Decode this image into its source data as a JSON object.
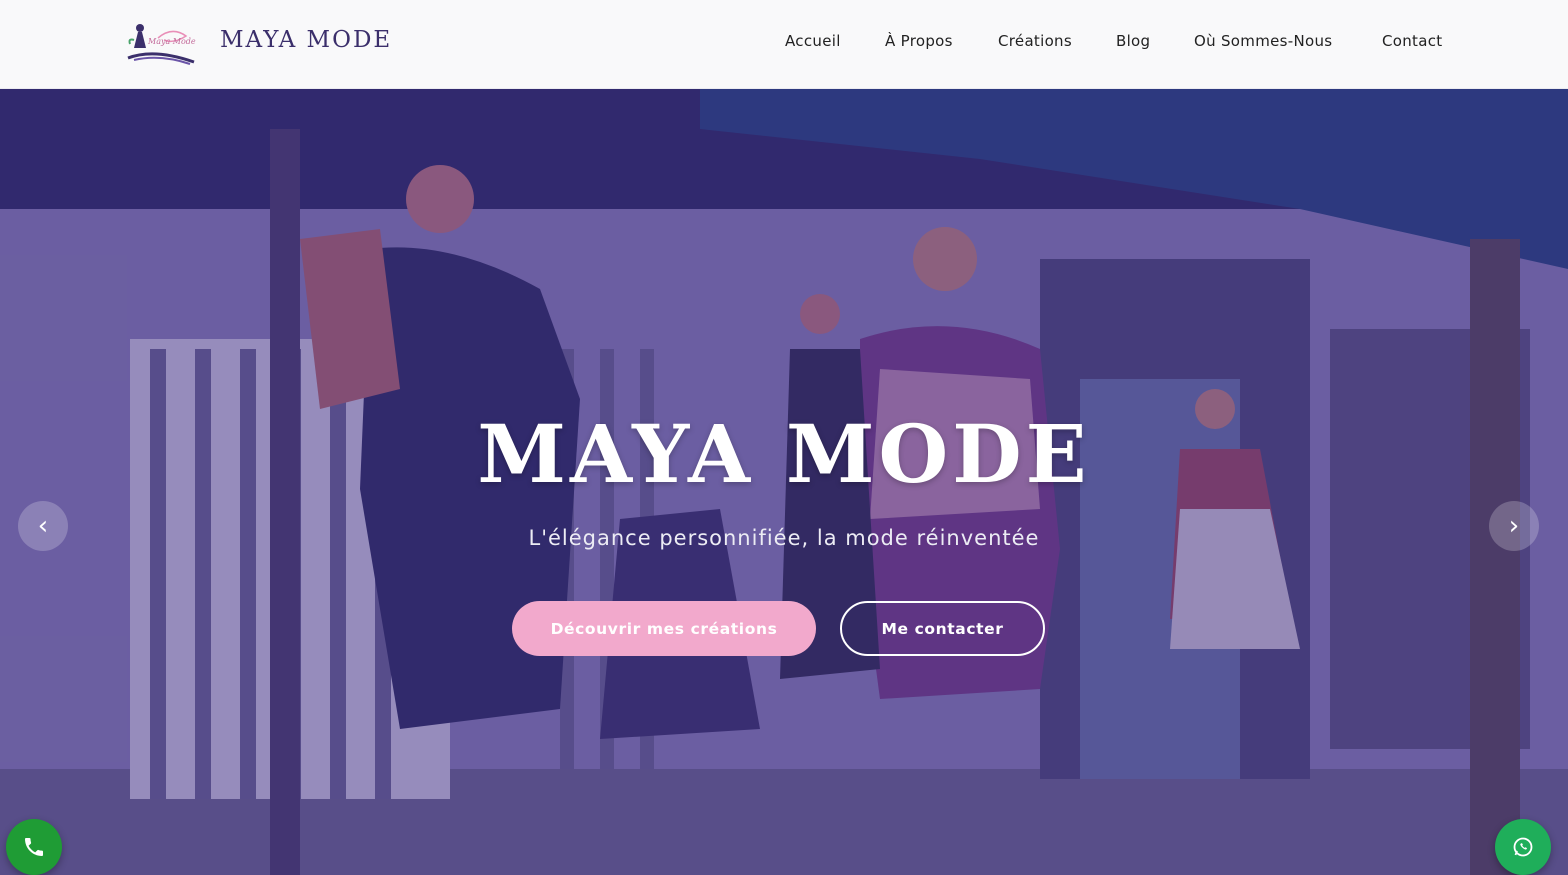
{
  "header": {
    "brand": "MAYA MODE",
    "logo_text": "Maya Mode",
    "nav": [
      "Accueil",
      "À Propos",
      "Créations",
      "Blog",
      "Où Sommes-Nous",
      "Contact"
    ]
  },
  "hero": {
    "title": "MAYA MODE",
    "subtitle": "L'élégance personnifiée, la mode réinventée",
    "primary_button": "Découvrir mes créations",
    "secondary_button": "Me contacter",
    "prev_arrow": "‹",
    "next_arrow": "›"
  },
  "floating": {
    "phone_icon": "phone-icon",
    "whatsapp_icon": "whatsapp-icon"
  },
  "colors": {
    "brand": "#3b2f6b",
    "overlay": "#3a2882",
    "accent_pink": "#f2a9cc",
    "phone_green": "#1f9c35",
    "whatsapp_green": "#1fae5a"
  }
}
